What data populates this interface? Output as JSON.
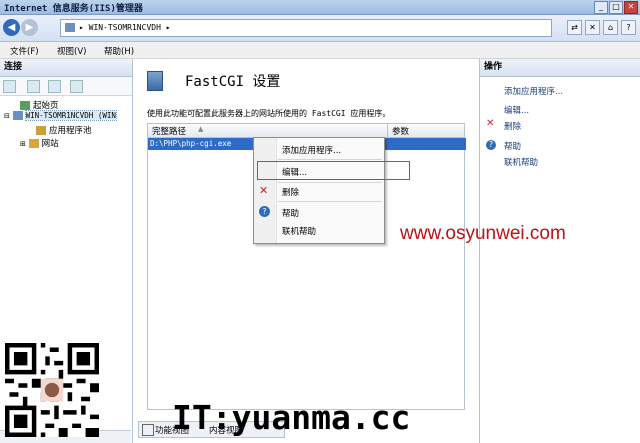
{
  "window": {
    "title": "Internet 信息服务(IIS)管理器"
  },
  "address": {
    "path": "WIN-TSOMR1NCVDH"
  },
  "menu": {
    "file": "文件(F)",
    "view": "视图(V)",
    "help": "帮助(H)"
  },
  "left": {
    "header": "连接",
    "tree": [
      "起始页",
      "WIN-TSOMR1NCVDH (WIN",
      "应用程序池",
      "网站"
    ]
  },
  "center": {
    "title": "FastCGI 设置",
    "description": "使用此功能可配置此服务器上的网站所使用的 FastCGI 应用程序。",
    "columns": [
      "完整路径",
      "参数"
    ],
    "row": "D:\\PHP\\php-cgi.exe",
    "bottom_tab": "功能视图",
    "bottom_tab2": "内容视图"
  },
  "context_menu": [
    "添加应用程序...",
    "编辑...",
    "删除",
    "帮助",
    "联机帮助"
  ],
  "right": {
    "header": "操作",
    "items": [
      "添加应用程序...",
      "编辑...",
      "删除",
      "帮助",
      "联机帮助"
    ]
  },
  "watermark": {
    "url": "www.osyunwei.com",
    "site": "IT:yuanma.cc"
  }
}
